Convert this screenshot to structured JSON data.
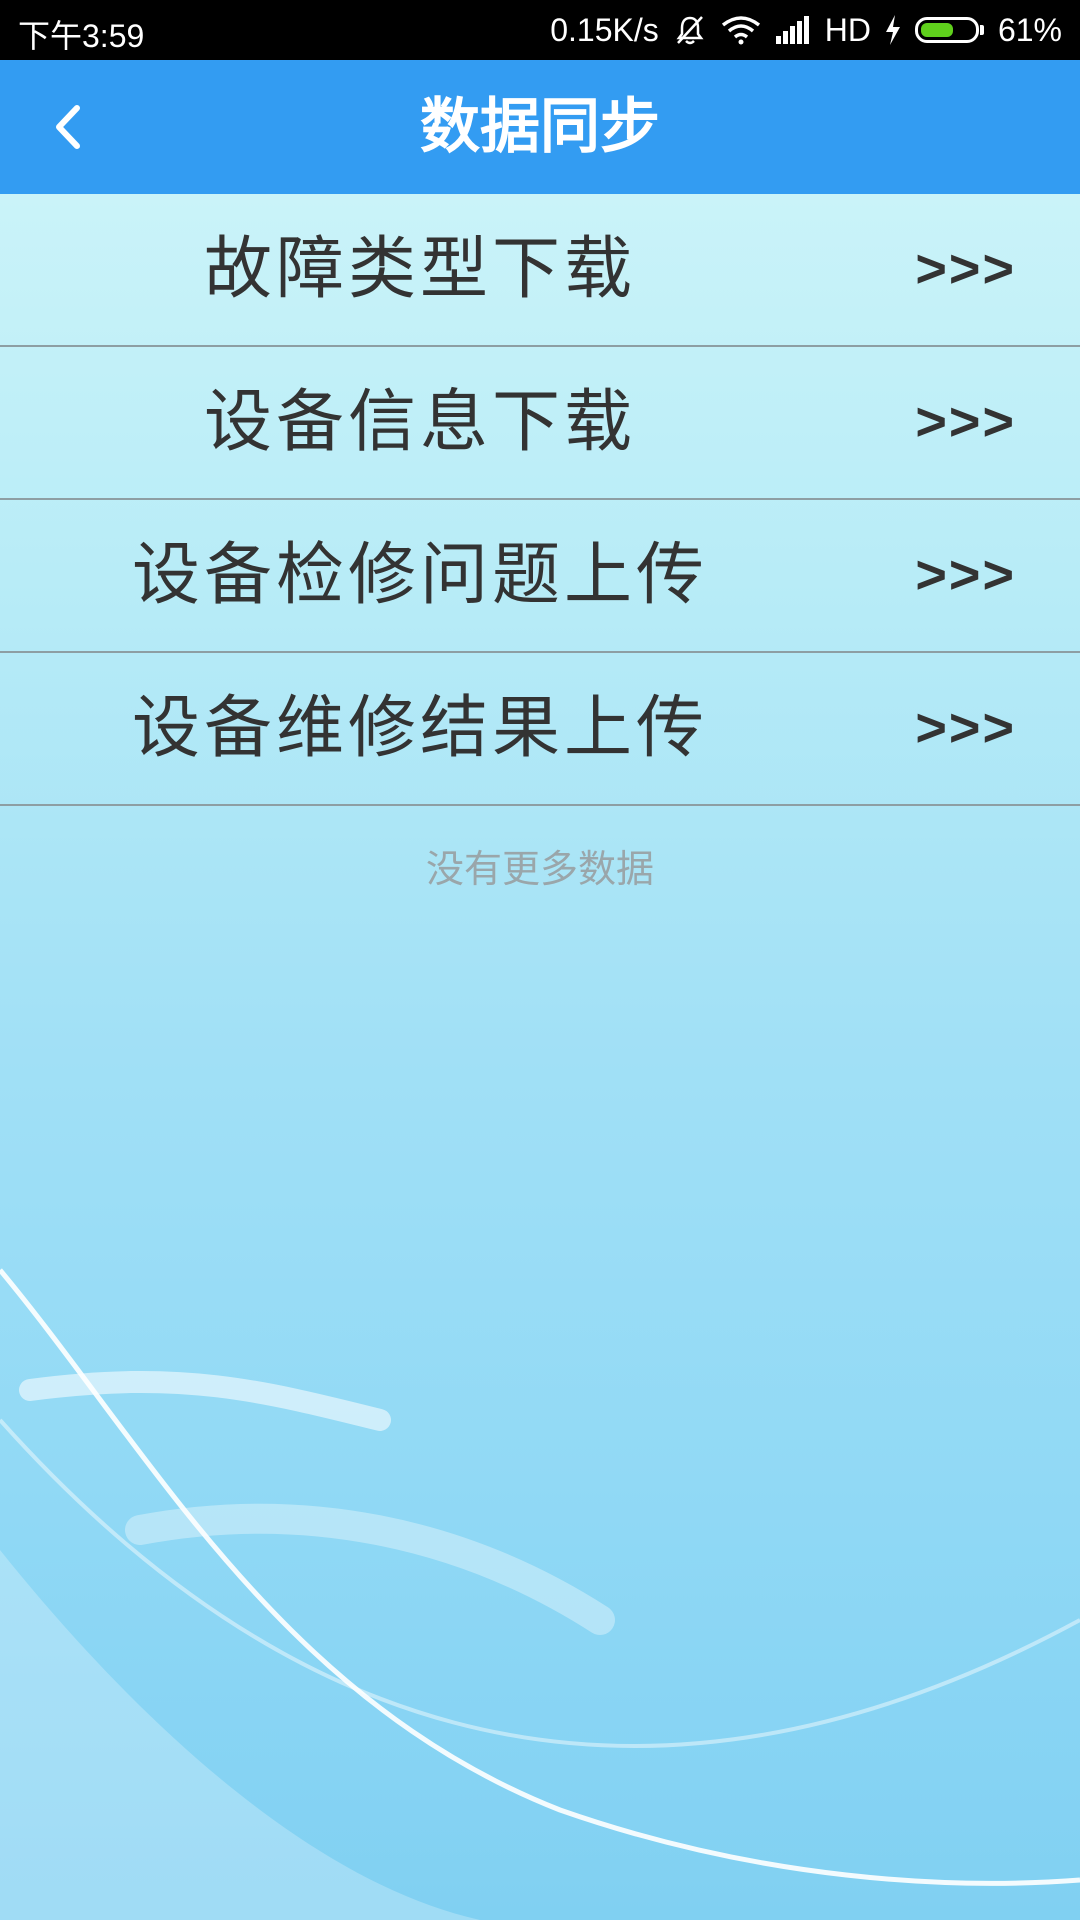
{
  "status_bar": {
    "time": "下午3:59",
    "net_speed": "0.15K/s",
    "network_label": "HD",
    "battery_percent": "61%",
    "battery_level": 0.61,
    "icons": [
      "mute-icon",
      "wifi-icon",
      "signal-icon",
      "charging-icon",
      "battery-icon"
    ],
    "battery_color": "#5fd01c"
  },
  "app_bar": {
    "title": "数据同步",
    "back_icon": "chevron-left-icon",
    "background_color": "#339cf2"
  },
  "menu": {
    "items": [
      {
        "label": "故障类型下载",
        "arrow": ">>>"
      },
      {
        "label": "设备信息下载",
        "arrow": ">>>"
      },
      {
        "label": "设备检修问题上传",
        "arrow": ">>>"
      },
      {
        "label": "设备维修结果上传",
        "arrow": ">>>"
      }
    ]
  },
  "footer": {
    "no_more_text": "没有更多数据"
  }
}
